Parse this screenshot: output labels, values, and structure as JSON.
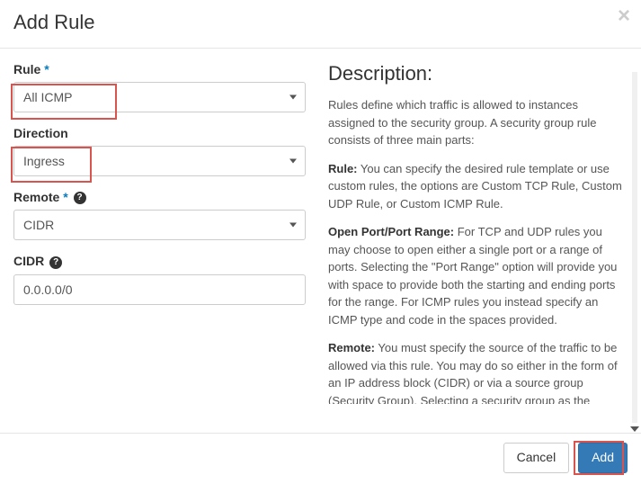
{
  "header": {
    "title": "Add Rule"
  },
  "form": {
    "rule": {
      "label": "Rule",
      "value": "All ICMP"
    },
    "direction": {
      "label": "Direction",
      "value": "Ingress"
    },
    "remote": {
      "label": "Remote",
      "value": "CIDR"
    },
    "cidr": {
      "label": "CIDR",
      "value": "0.0.0.0/0"
    }
  },
  "description": {
    "heading": "Description:",
    "intro": "Rules define which traffic is allowed to instances assigned to the security group. A security group rule consists of three main parts:",
    "rule_label": "Rule:",
    "rule_text": " You can specify the desired rule template or use custom rules, the options are Custom TCP Rule, Custom UDP Rule, or Custom ICMP Rule.",
    "port_label": "Open Port/Port Range:",
    "port_text": " For TCP and UDP rules you may choose to open either a single port or a range of ports. Selecting the \"Port Range\" option will provide you with space to provide both the starting and ending ports for the range. For ICMP rules you instead specify an ICMP type and code in the spaces provided.",
    "remote_label": "Remote:",
    "remote_text": " You must specify the source of the traffic to be allowed via this rule. You may do so either in the form of an IP address block (CIDR) or via a source group (Security Group). Selecting a security group as the source will allow any other instance in that security group access to any other instance via this rule."
  },
  "footer": {
    "cancel": "Cancel",
    "add": "Add"
  }
}
